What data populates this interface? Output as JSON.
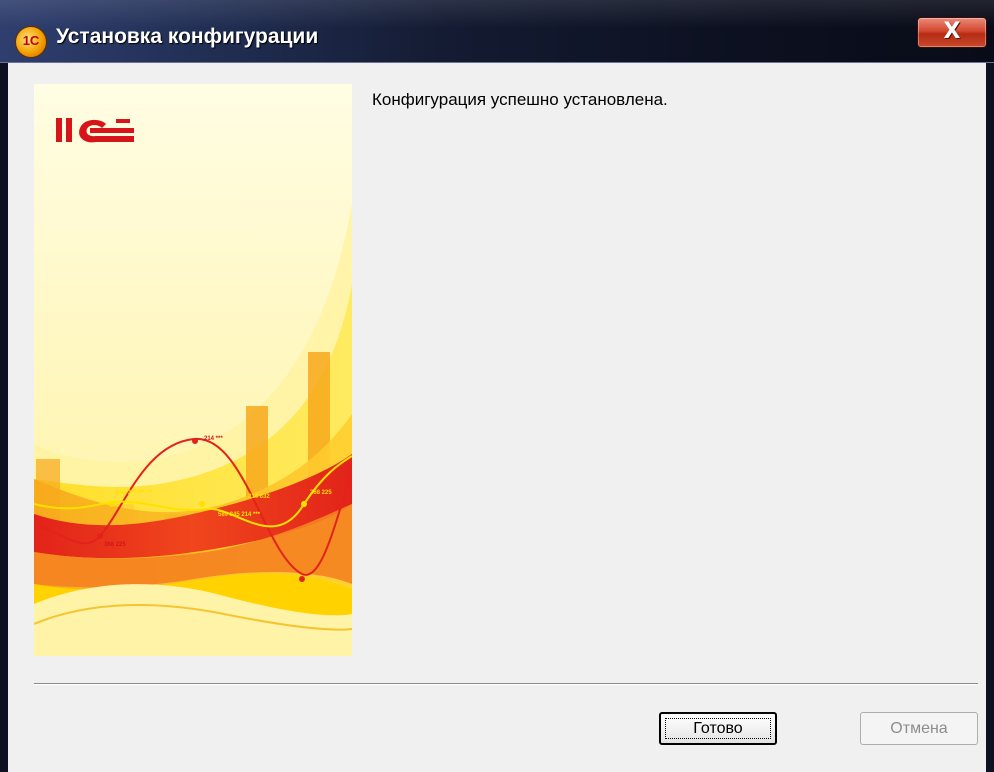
{
  "window": {
    "title": "Установка конфигурации",
    "close_label": "X"
  },
  "banner": {
    "logo_text": "1С",
    "chart_labels": [
      "214 ***",
      "843 3** *** ***",
      "214 632",
      "268 225",
      "589 845 214 ***",
      "368 225"
    ]
  },
  "content": {
    "message": "Конфигурация успешно установлена."
  },
  "buttons": {
    "finish": "Готово",
    "cancel": "Отмена"
  },
  "colors": {
    "titlebar_dark": "#0c1020",
    "banner_bg": "#fffbd6",
    "accent_red": "#e2231a",
    "accent_orange": "#f7a81b"
  }
}
